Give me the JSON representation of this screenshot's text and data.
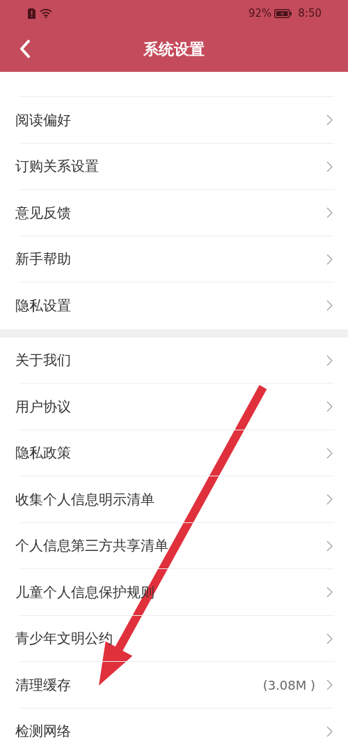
{
  "status_bar": {
    "battery": "92%",
    "time": "8:50"
  },
  "header": {
    "title": "系统设置"
  },
  "groups": [
    {
      "items": [
        {
          "label": "阅读偏好"
        },
        {
          "label": "订购关系设置"
        },
        {
          "label": "意见反馈"
        },
        {
          "label": "新手帮助"
        },
        {
          "label": "隐私设置"
        }
      ]
    },
    {
      "items": [
        {
          "label": "关于我们"
        },
        {
          "label": "用户协议"
        },
        {
          "label": "隐私政策"
        },
        {
          "label": "收集个人信息明示清单"
        },
        {
          "label": "个人信息第三方共享清单"
        },
        {
          "label": "儿童个人信息保护规则"
        },
        {
          "label": "青少年文明公约"
        },
        {
          "label": "清理缓存",
          "value": "(3.08M )"
        },
        {
          "label": "检测网络"
        }
      ]
    }
  ]
}
